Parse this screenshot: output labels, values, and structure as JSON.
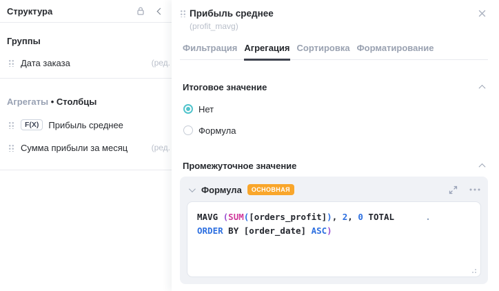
{
  "left_panel": {
    "title": "Структура",
    "icons": {
      "lock": "lock-icon",
      "collapse": "chevron-left-icon"
    },
    "groups_section": {
      "header": "Группы",
      "items": [
        {
          "label": "Дата заказа",
          "suffix": "(ред."
        }
      ]
    },
    "aggregates_section": {
      "header_primary": "Агрегаты",
      "header_separator": "•",
      "header_secondary": "Столбцы",
      "items": [
        {
          "badge": "F(X)",
          "label": "Прибыль среднее",
          "suffix": ""
        },
        {
          "badge": "",
          "label": "Сумма прибыли за месяц",
          "suffix": "(ред."
        }
      ]
    }
  },
  "panel": {
    "title": "Прибыль среднее",
    "subtitle": "(profit_mavg)",
    "tabs": [
      {
        "label": "Фильтрация",
        "active": false
      },
      {
        "label": "Агрегация",
        "active": true
      },
      {
        "label": "Сортировка",
        "active": false
      },
      {
        "label": "Форматирование",
        "active": false
      }
    ],
    "total_section": {
      "title": "Итоговое значение",
      "options": [
        {
          "label": "Нет",
          "selected": true
        },
        {
          "label": "Формула",
          "selected": false
        }
      ]
    },
    "intermediate_section": {
      "title": "Промежуточное значение",
      "formula_card": {
        "title": "Формула",
        "badge": "ОСНОВНАЯ",
        "code_text": "MAVG (SUM([orders_profit]), 2, 0 TOTAL      .\nORDER BY [order_date] ASC)",
        "code_lines": [
          [
            {
              "t": "MAVG ",
              "c": "plain"
            },
            {
              "t": "(",
              "c": "p1"
            },
            {
              "t": "SUM",
              "c": "fn"
            },
            {
              "t": "(",
              "c": "p2"
            },
            {
              "t": "[orders_profit]",
              "c": "plain"
            },
            {
              "t": ")",
              "c": "p2"
            },
            {
              "t": ", ",
              "c": "plain"
            },
            {
              "t": "2",
              "c": "num"
            },
            {
              "t": ", ",
              "c": "plain"
            },
            {
              "t": "0",
              "c": "num"
            },
            {
              "t": " TOTAL",
              "c": "plain"
            },
            {
              "t": "      ",
              "c": "plain"
            },
            {
              "t": ".",
              "c": "dim"
            }
          ],
          [
            {
              "t": "ORDER",
              "c": "kw"
            },
            {
              "t": " BY ",
              "c": "plain"
            },
            {
              "t": "[order_date]",
              "c": "plain"
            },
            {
              "t": " ",
              "c": "plain"
            },
            {
              "t": "ASC",
              "c": "kw"
            },
            {
              "t": ")",
              "c": "p1"
            }
          ]
        ]
      }
    }
  },
  "colors": {
    "accent_radio": "#52c4cc",
    "badge_orange": "#f9a62b",
    "tab_active_underline": "#3d424d",
    "code_function": "#d0399b",
    "code_keyword": "#2d6fe0",
    "code_paren_outer": "#9a4fd0",
    "code_paren_inner": "#2d6fe0",
    "divider": "#e8eaee",
    "muted_text": "#b9bfca"
  }
}
